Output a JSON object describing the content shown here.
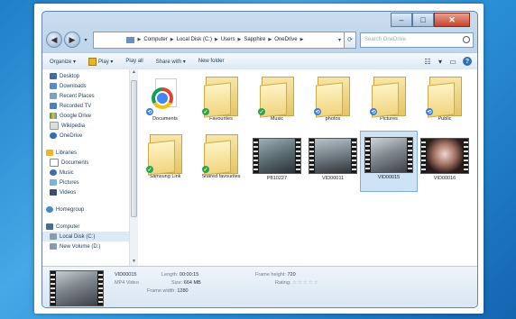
{
  "address": {
    "crumbs": [
      "Computer",
      "Local Disk (C:)",
      "Users",
      "Sapphire",
      "OneDrive"
    ],
    "search_placeholder": "Search OneDrive"
  },
  "toolbar": {
    "organize": "Organize ▾",
    "play": "Play ▾",
    "play_all": "Play all",
    "share_with": "Share with ▾",
    "new_folder": "New folder"
  },
  "nav": {
    "favorites": [
      "Desktop",
      "Downloads",
      "Recent Places",
      "Recorded TV",
      "Google Drive",
      "Wikipedia",
      "OneDrive"
    ],
    "libraries": "Libraries",
    "library_items": [
      "Documents",
      "Music",
      "Pictures",
      "Videos"
    ],
    "homegroup": "Homegroup",
    "computer": "Computer",
    "drives": [
      "Local Disk (C:)",
      "New Volume (D:)"
    ]
  },
  "items": [
    {
      "label": "Documents",
      "icon": "chrome-icon",
      "status": "sync"
    },
    {
      "label": "Favourites",
      "icon": "folder-icon",
      "status": "ok"
    },
    {
      "label": "Music",
      "icon": "folder-icon",
      "status": "ok"
    },
    {
      "label": "photos",
      "icon": "folder-icon",
      "status": "sync"
    },
    {
      "label": "Pictures",
      "icon": "folder-icon",
      "status": "sync"
    },
    {
      "label": "Public",
      "icon": "folder-icon",
      "status": "sync"
    },
    {
      "label": "Samsung Link",
      "icon": "folder-icon",
      "status": "ok"
    },
    {
      "label": "Shared favourites",
      "icon": "folder-icon",
      "status": "ok"
    },
    {
      "label": "P810227",
      "icon": "video-icon",
      "status": "none"
    },
    {
      "label": "VID00011",
      "icon": "video-icon",
      "status": "none"
    },
    {
      "label": "VID00015",
      "icon": "video-icon",
      "status": "none"
    },
    {
      "label": "VID00016",
      "icon": "video-icon",
      "status": "none"
    }
  ],
  "details": {
    "name": "VID00015",
    "type": "MP4 Video",
    "length_label": "Length:",
    "length": "00:00:15",
    "size_label": "Size:",
    "size": "664 MB",
    "frame_width_label": "Frame width:",
    "frame_width": "1280",
    "frame_height_label": "Frame height:",
    "frame_height": "720",
    "rating_label": "Rating:",
    "rating": "☆☆☆☆☆"
  }
}
